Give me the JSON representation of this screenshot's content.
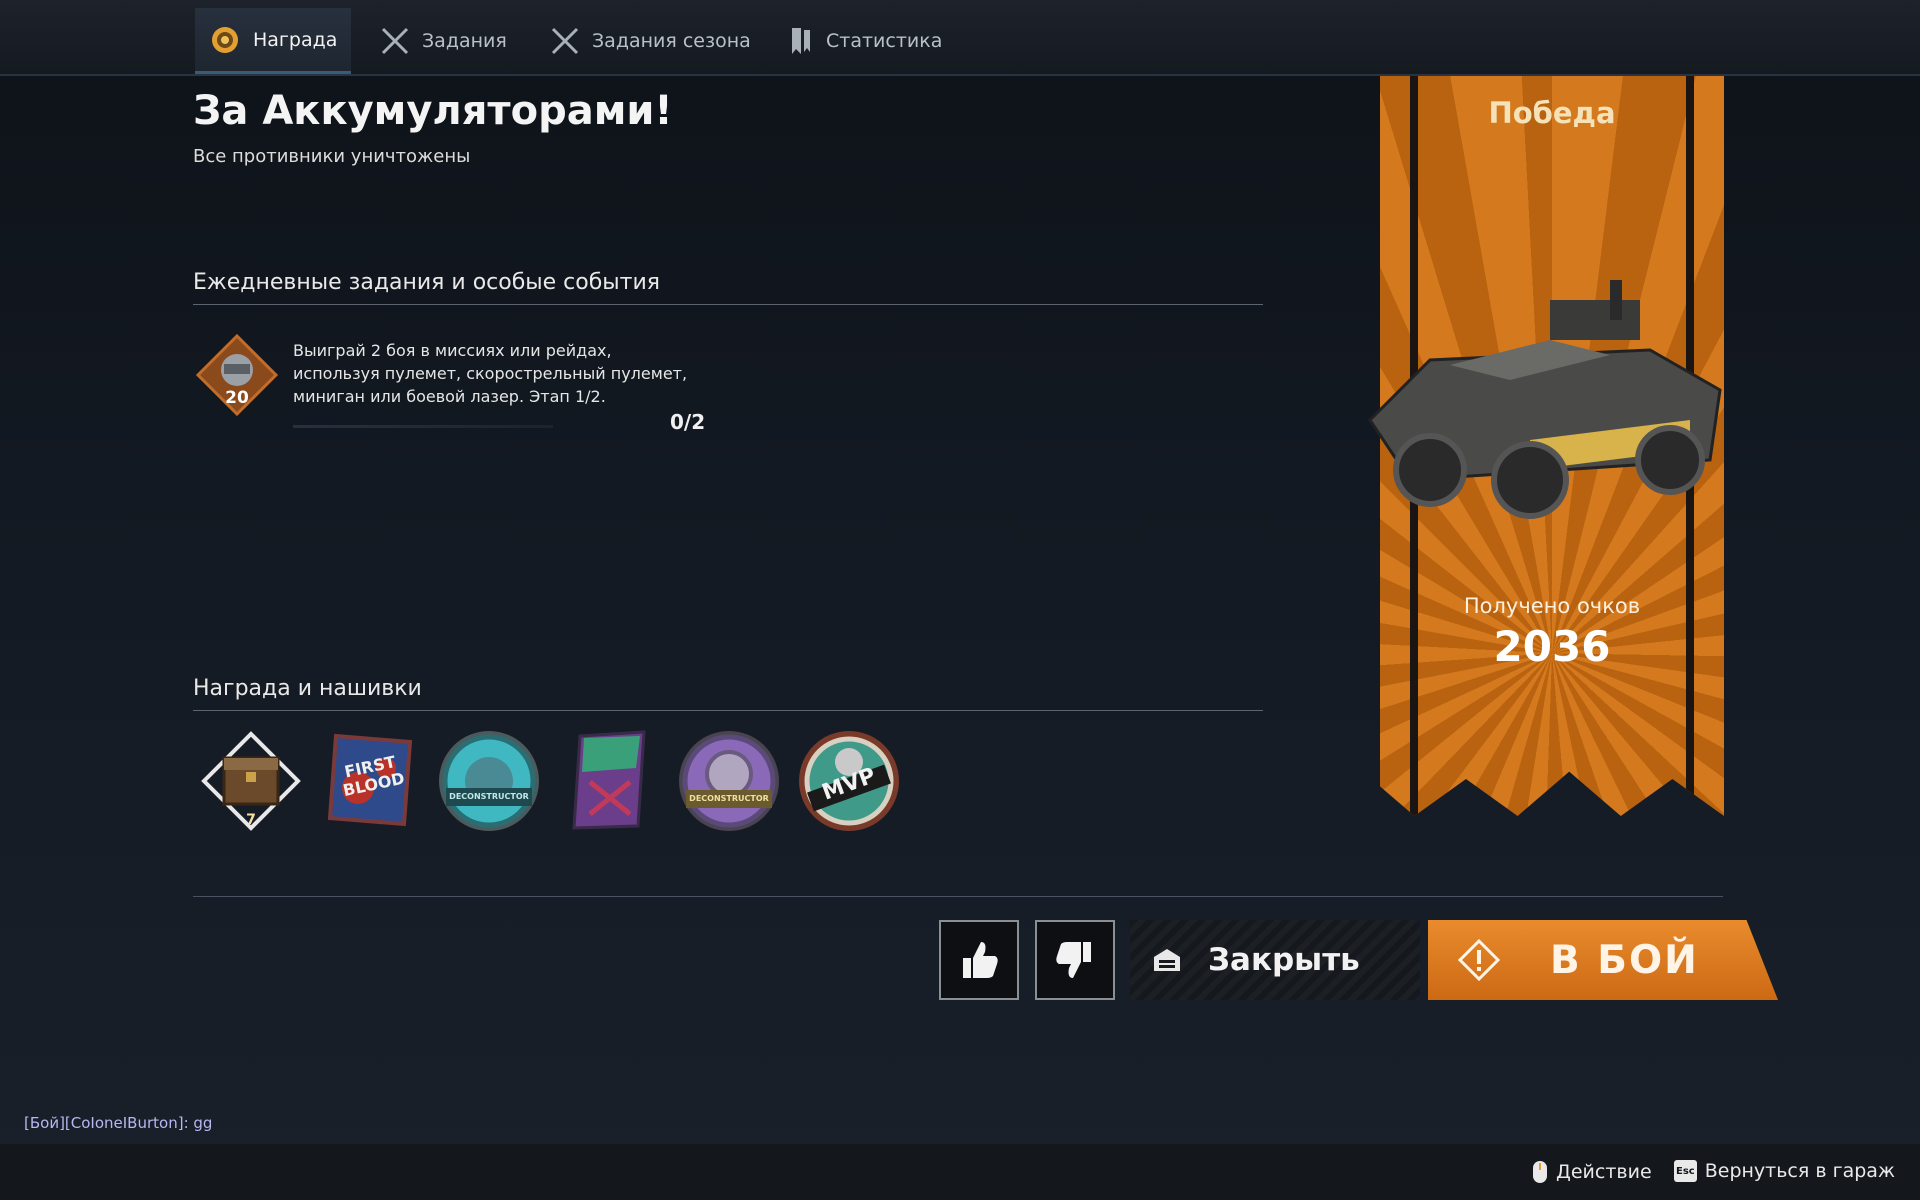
{
  "tabs": [
    {
      "label": "Награда",
      "icon": "medal-icon",
      "active": true
    },
    {
      "label": "Задания",
      "icon": "crossed-swords-icon",
      "active": false
    },
    {
      "label": "Задания сезона",
      "icon": "crossed-swords-icon",
      "active": false
    },
    {
      "label": "Статистика",
      "icon": "bookmark-icon",
      "active": false
    }
  ],
  "header": {
    "title": "За Аккумуляторами!",
    "subtitle": "Все противники уничтожены"
  },
  "daily": {
    "section_title": "Ежедневные задания и особые события",
    "task": {
      "badge_value": "20",
      "text_line1": "Выиграй 2 боя в миссиях или рейдах,",
      "text_line2": "используя пулемет, скорострельный пулемет,",
      "text_line3": "миниган или боевой лазер. Этап 1/2.",
      "progress": "0/2"
    }
  },
  "rewards": {
    "section_title": "Награда и нашивки",
    "items": [
      {
        "name": "crate",
        "count": "7"
      },
      {
        "name": "first-blood-patch",
        "text": "FIRST BLOOD"
      },
      {
        "name": "deconstructor-teal-badge",
        "text": "DECONSTRUCTOR"
      },
      {
        "name": "purple-sticker"
      },
      {
        "name": "deconstructor-purple-badge",
        "text": "DECONSTRUCTOR"
      },
      {
        "name": "mvp-badge",
        "text": "MVP"
      }
    ]
  },
  "banner": {
    "result": "Победа",
    "score_label": "Получено очков",
    "score": "2036"
  },
  "actions": {
    "close_label": "Закрыть",
    "battle_label": "В БОЙ"
  },
  "chat": {
    "message": "[Бой][CoIoneIBurton]: gg"
  },
  "footer": {
    "action_label": "Действие",
    "esc_key": "Esc",
    "garage_label": "Вернуться в гараж"
  },
  "colors": {
    "accent_orange": "#cc6a14",
    "banner_orange": "#d4791d",
    "background": "#131922"
  }
}
